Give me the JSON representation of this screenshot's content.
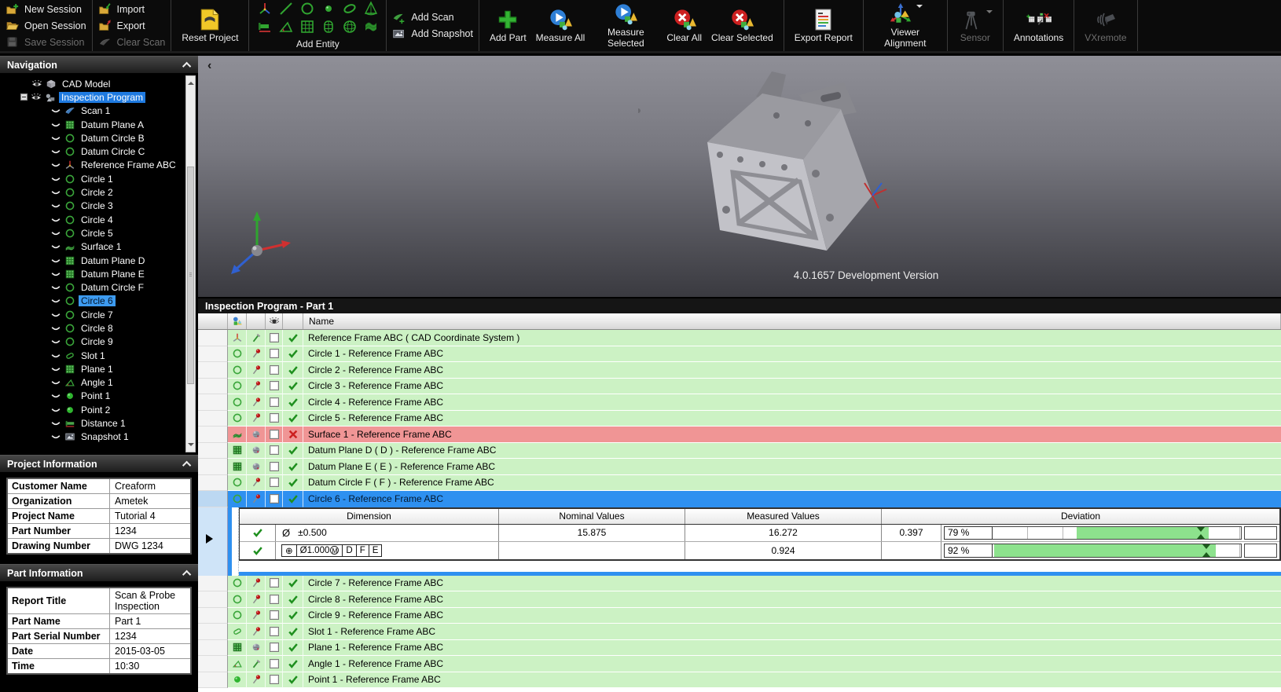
{
  "toolbar": {
    "groups": [
      {
        "type": "stack",
        "items": [
          {
            "label": "New Session",
            "icon": "new-session",
            "enabled": true
          },
          {
            "label": "Open Session",
            "icon": "open-session",
            "enabled": true
          },
          {
            "label": "Save Session",
            "icon": "save-session",
            "enabled": false
          }
        ]
      },
      {
        "type": "stack",
        "items": [
          {
            "label": "Import",
            "icon": "import",
            "enabled": true
          },
          {
            "label": "Export",
            "icon": "export",
            "enabled": true
          },
          {
            "label": "Clear Scan",
            "icon": "clear-scan",
            "enabled": false
          }
        ]
      },
      {
        "type": "big",
        "items": [
          {
            "label": "Reset Project",
            "icon": "reset-project",
            "enabled": true
          }
        ]
      },
      {
        "type": "entity-grid",
        "label": "Add Entity",
        "icons": [
          "entity-frame",
          "entity-line",
          "entity-circle",
          "entity-point",
          "entity-ellipse",
          "entity-cone",
          "entity-distance",
          "entity-angle",
          "entity-plane",
          "entity-cylinder",
          "entity-sphere",
          "entity-surface"
        ]
      },
      {
        "type": "stack",
        "items": [
          {
            "label": "Add Scan",
            "icon": "add-scan",
            "enabled": true
          },
          {
            "label": "Add Snapshot",
            "icon": "add-snapshot",
            "enabled": true
          }
        ]
      },
      {
        "type": "big",
        "items": [
          {
            "label": "Add Part",
            "icon": "add-part",
            "enabled": true
          },
          {
            "label": "Measure All",
            "icon": "measure-all",
            "enabled": true
          },
          {
            "label": "Measure Selected",
            "icon": "measure-selected",
            "enabled": true
          },
          {
            "label": "Clear All",
            "icon": "clear-all",
            "enabled": true
          },
          {
            "label": "Clear Selected",
            "icon": "clear-selected",
            "enabled": true
          }
        ]
      },
      {
        "type": "big",
        "items": [
          {
            "label": "Export Report",
            "icon": "export-report",
            "enabled": true
          }
        ]
      },
      {
        "type": "big",
        "items": [
          {
            "label": "Viewer Alignment",
            "icon": "viewer-alignment",
            "enabled": true,
            "dropdown": true
          }
        ]
      },
      {
        "type": "big",
        "items": [
          {
            "label": "Sensor",
            "icon": "sensor",
            "enabled": false,
            "dropdown": true
          }
        ]
      },
      {
        "type": "big",
        "items": [
          {
            "label": "Annotations",
            "icon": "annotations",
            "enabled": true
          }
        ]
      },
      {
        "type": "big",
        "items": [
          {
            "label": "VXremote",
            "icon": "vxremote",
            "enabled": false
          }
        ]
      }
    ]
  },
  "navigation": {
    "title": "Navigation",
    "items": [
      {
        "label": "CAD Model",
        "icon": "cad-box",
        "depth": 1,
        "eye": "open"
      },
      {
        "label": "Inspection Program",
        "icon": "program",
        "depth": 1,
        "eye": "open",
        "expander": true,
        "selected": "primary"
      },
      {
        "label": "Scan 1",
        "icon": "scan",
        "depth": 2,
        "eye": "crescent"
      },
      {
        "label": "Datum Plane A",
        "icon": "plane",
        "depth": 2,
        "eye": "crescent"
      },
      {
        "label": "Datum Circle B",
        "icon": "circle",
        "depth": 2,
        "eye": "crescent"
      },
      {
        "label": "Datum Circle C",
        "icon": "circle",
        "depth": 2,
        "eye": "crescent"
      },
      {
        "label": "Reference Frame ABC",
        "icon": "triad",
        "depth": 2,
        "eye": "crescent"
      },
      {
        "label": "Circle 1",
        "icon": "circle",
        "depth": 2,
        "eye": "crescent"
      },
      {
        "label": "Circle 2",
        "icon": "circle",
        "depth": 2,
        "eye": "crescent"
      },
      {
        "label": "Circle 3",
        "icon": "circle",
        "depth": 2,
        "eye": "crescent"
      },
      {
        "label": "Circle 4",
        "icon": "circle",
        "depth": 2,
        "eye": "crescent"
      },
      {
        "label": "Circle 5",
        "icon": "circle",
        "depth": 2,
        "eye": "crescent"
      },
      {
        "label": "Surface 1",
        "icon": "mesh",
        "depth": 2,
        "eye": "crescent"
      },
      {
        "label": "Datum Plane D",
        "icon": "plane",
        "depth": 2,
        "eye": "crescent"
      },
      {
        "label": "Datum Plane E",
        "icon": "plane",
        "depth": 2,
        "eye": "crescent"
      },
      {
        "label": "Datum Circle F",
        "icon": "circle",
        "depth": 2,
        "eye": "crescent"
      },
      {
        "label": "Circle 6",
        "icon": "circle",
        "depth": 2,
        "eye": "crescent",
        "selected": "secondary"
      },
      {
        "label": "Circle 7",
        "icon": "circle",
        "depth": 2,
        "eye": "crescent"
      },
      {
        "label": "Circle 8",
        "icon": "circle",
        "depth": 2,
        "eye": "crescent"
      },
      {
        "label": "Circle 9",
        "icon": "circle",
        "depth": 2,
        "eye": "crescent"
      },
      {
        "label": "Slot 1",
        "icon": "slot",
        "depth": 2,
        "eye": "crescent"
      },
      {
        "label": "Plane 1",
        "icon": "plane",
        "depth": 2,
        "eye": "crescent"
      },
      {
        "label": "Angle 1",
        "icon": "angle",
        "depth": 2,
        "eye": "crescent"
      },
      {
        "label": "Point 1",
        "icon": "point",
        "depth": 2,
        "eye": "crescent"
      },
      {
        "label": "Point 2",
        "icon": "point",
        "depth": 2,
        "eye": "crescent"
      },
      {
        "label": "Distance 1",
        "icon": "distance",
        "depth": 2,
        "eye": "crescent"
      },
      {
        "label": "Snapshot 1",
        "icon": "snapshot",
        "depth": 2,
        "eye": "crescent"
      }
    ]
  },
  "project_information": {
    "title": "Project Information",
    "rows": [
      {
        "label": "Customer Name",
        "value": "Creaform"
      },
      {
        "label": "Organization",
        "value": "Ametek"
      },
      {
        "label": "Project Name",
        "value": "Tutorial 4"
      },
      {
        "label": "Part Number",
        "value": "1234"
      },
      {
        "label": "Drawing Number",
        "value": "DWG 1234"
      }
    ]
  },
  "part_information": {
    "title": "Part Information",
    "rows": [
      {
        "label": "Report Title",
        "value": "Scan & Probe Inspection"
      },
      {
        "label": "Part Name",
        "value": "Part 1"
      },
      {
        "label": "Part Serial Number",
        "value": "1234"
      },
      {
        "label": "Date",
        "value": "2015-03-05"
      },
      {
        "label": "Time",
        "value": "10:30"
      }
    ]
  },
  "viewport": {
    "version_text": "4.0.1657 Development Version",
    "collapse_glyph": "‹"
  },
  "inspection_table": {
    "title": "Inspection Program - Part 1",
    "name_header": "Name",
    "rows": [
      {
        "name": "Reference Frame ABC ( CAD Coordinate System )",
        "icon": "triad",
        "probe": "probe-green",
        "status": "pass",
        "state": "normal"
      },
      {
        "name": "Circle 1 - Reference Frame ABC",
        "icon": "circle",
        "probe": "probe-red",
        "status": "pass",
        "state": "normal"
      },
      {
        "name": "Circle 2 - Reference Frame ABC",
        "icon": "circle",
        "probe": "probe-red",
        "status": "pass",
        "state": "normal"
      },
      {
        "name": "Circle 3 - Reference Frame ABC",
        "icon": "circle",
        "probe": "probe-red",
        "status": "pass",
        "state": "normal"
      },
      {
        "name": "Circle 4 - Reference Frame ABC",
        "icon": "circle",
        "probe": "probe-red",
        "status": "pass",
        "state": "normal"
      },
      {
        "name": "Circle 5 - Reference Frame ABC",
        "icon": "circle",
        "probe": "probe-red",
        "status": "pass",
        "state": "normal"
      },
      {
        "name": "Surface 1 - Reference Frame ABC",
        "icon": "mesh",
        "probe": "scanner",
        "status": "fail",
        "state": "error"
      },
      {
        "name": "Datum Plane D ( D )  - Reference Frame ABC",
        "icon": "plane",
        "probe": "scanner",
        "status": "pass",
        "state": "normal"
      },
      {
        "name": "Datum Plane E ( E )  - Reference Frame ABC",
        "icon": "plane",
        "probe": "scanner",
        "status": "pass",
        "state": "normal"
      },
      {
        "name": "Datum Circle F ( F )  - Reference Frame ABC",
        "icon": "circle",
        "probe": "probe-red",
        "status": "pass",
        "state": "normal"
      },
      {
        "name": "Circle 6 - Reference Frame ABC",
        "icon": "circle",
        "probe": "probe-red",
        "status": "pass",
        "state": "selected",
        "detail": true
      },
      {
        "name": "Circle 7 - Reference Frame ABC",
        "icon": "circle",
        "probe": "probe-red",
        "status": "pass",
        "state": "normal"
      },
      {
        "name": "Circle 8 - Reference Frame ABC",
        "icon": "circle",
        "probe": "probe-red",
        "status": "pass",
        "state": "normal"
      },
      {
        "name": "Circle 9 - Reference Frame ABC",
        "icon": "circle",
        "probe": "probe-red",
        "status": "pass",
        "state": "normal"
      },
      {
        "name": "Slot 1 - Reference Frame ABC",
        "icon": "slot",
        "probe": "probe-red",
        "status": "pass",
        "state": "normal"
      },
      {
        "name": "Plane 1 - Reference Frame ABC",
        "icon": "plane",
        "probe": "scanner",
        "status": "pass",
        "state": "normal"
      },
      {
        "name": "Angle 1 - Reference Frame ABC",
        "icon": "angle",
        "probe": "probe-green",
        "status": "pass",
        "state": "normal"
      },
      {
        "name": "Point 1 - Reference Frame ABC",
        "icon": "point",
        "probe": "probe-red",
        "status": "pass",
        "state": "normal"
      }
    ],
    "detail": {
      "headers": {
        "dimension": "Dimension",
        "nominal": "Nominal Values",
        "measured": "Measured Values",
        "deviation": "Deviation"
      },
      "rows": [
        {
          "dim_symbol": "Ø",
          "dim_text": "±0.500",
          "nominal": "15.875",
          "measured": "16.272",
          "dev_value": "0.397",
          "percent": "79 %",
          "bar": {
            "start_pct": 34,
            "end_pct": 87,
            "marker_pct": 84
          }
        },
        {
          "fcf": {
            "symbol": "⊕",
            "tolerance": "Ø1.000",
            "modifier": "M",
            "datums": [
              "D",
              "F",
              "E"
            ]
          },
          "nominal": "",
          "measured": "0.924",
          "dev_value": "",
          "percent": "92 %",
          "bar": {
            "start_pct": 0.5,
            "end_pct": 90,
            "marker_pct": 86
          }
        }
      ]
    }
  }
}
